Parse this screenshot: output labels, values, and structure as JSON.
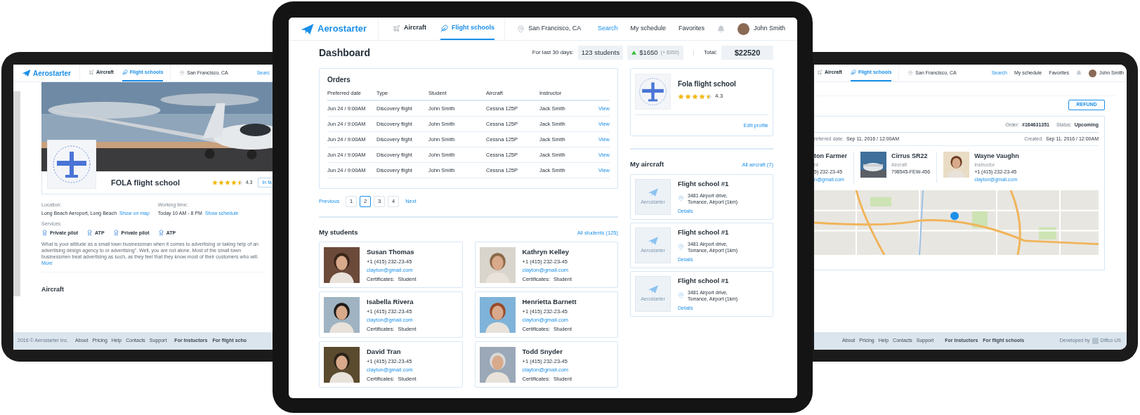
{
  "left_screen": {
    "nav": {
      "logo": "Aerostarter",
      "items": [
        {
          "label": "Aircraft",
          "selected": false
        },
        {
          "label": "Flight schools",
          "selected": true
        }
      ],
      "location": "San Francisco, CA",
      "links": [
        {
          "label": "Searc",
          "selected": true
        }
      ]
    },
    "profile": {
      "name": "FOLA flight school",
      "stars": 4.5,
      "rating": "4.3",
      "action": "In fa",
      "location_label": "Location:",
      "location": "Long Beach Aeroport, Long Beach",
      "map_link": "Show on map",
      "hours_label": "Working time:",
      "hours": "Today 10 AM - 8 PM",
      "schedule_link": "Show schedule",
      "services_label": "Services:",
      "services": [
        "Private pilot",
        "ATP",
        "Private pilot",
        "ATP"
      ],
      "description": "What is your attitude as a small town businessman when it comes to advertising or taking help of an advertising design agency to or advertising\". Well, you are not alone. Most of the small town businessmen treat advertising as such, as they feel that they know most of their customers who will.",
      "more": "More",
      "section": "Aircraft"
    },
    "footer": {
      "copyright": "2016 © Aerostarter Inc.",
      "links": [
        "About",
        "Pricing",
        "Help",
        "Contacts",
        "Support"
      ],
      "roles": [
        "For Instuctors",
        "For flight scho"
      ]
    }
  },
  "center_screen": {
    "nav": {
      "logo": "Aerostarter",
      "items": [
        {
          "label": "Aircraft",
          "selected": false
        },
        {
          "label": "Flight schools",
          "selected": true
        }
      ],
      "location": "San Francisco, CA",
      "links": [
        {
          "label": "Search",
          "selected": true
        },
        {
          "label": "My schedule",
          "selected": false
        },
        {
          "label": "Favorites",
          "selected": false
        }
      ],
      "user": "John Smith"
    },
    "dashboard": {
      "title": "Dashboard",
      "period_label": "For last 30 days:",
      "students": "123 students",
      "revenue": "$1650",
      "revenue_delta": "(+ $350)",
      "total_label": "Total:",
      "total": "$22520"
    },
    "orders": {
      "title": "Orders",
      "columns": [
        "Preferred date",
        "Type",
        "Student",
        "Aircraft",
        "Instructor"
      ],
      "rows": [
        {
          "cells": [
            "Jun 24 / 9:00AM",
            "Discovery flight",
            "John Smith",
            "Cessna 125P",
            "Jack Smith"
          ],
          "action": "View"
        },
        {
          "cells": [
            "Jun 24 / 9:00AM",
            "Discovery flight",
            "John Smith",
            "Cessna 125P",
            "Jack Smith"
          ],
          "action": "View"
        },
        {
          "cells": [
            "Jun 24 / 9:00AM",
            "Discovery flight",
            "John Smith",
            "Cessna 125P",
            "Jack Smith"
          ],
          "action": "View"
        },
        {
          "cells": [
            "Jun 24 / 9:00AM",
            "Discovery flight",
            "John Smith",
            "Cessna 125P",
            "Jack Smith"
          ],
          "action": "View"
        },
        {
          "cells": [
            "Jun 24 / 9:00AM",
            "Discovery flight",
            "John Smith",
            "Cessna 125P",
            "Jack Smith"
          ],
          "action": "View"
        }
      ]
    },
    "pagination": {
      "previous": "Previous",
      "pages": [
        {
          "label": "1",
          "selected": false
        },
        {
          "label": "2",
          "selected": true
        },
        {
          "label": "3",
          "selected": false
        },
        {
          "label": "4",
          "selected": false
        }
      ],
      "next": "Next"
    },
    "students": {
      "title": "My students",
      "link": "All students (125)",
      "items": [
        {
          "name": "Susan Thomas",
          "phone": "+1 (415) 232-23-45",
          "email": "clayton@gmail.com",
          "cert_label": "Certificates:",
          "cert": "Student"
        },
        {
          "name": "Kathryn Kelley",
          "phone": "+1 (415) 232-23-45",
          "email": "clayton@gmail.com",
          "cert_label": "Certificates:",
          "cert": "Student"
        },
        {
          "name": "Isabella Rivera",
          "phone": "+1 (415) 232-23-45",
          "email": "clayton@gmail.com",
          "cert_label": "Certificates:",
          "cert": "Student"
        },
        {
          "name": "Henrietta Barnett",
          "phone": "+1 (415) 232-23-45",
          "email": "clayton@gmail.com",
          "cert_label": "Certificates:",
          "cert": "Student"
        },
        {
          "name": "David Tran",
          "phone": "+1 (415) 232-23-45",
          "email": "clayton@gmail.com",
          "cert_label": "Certificates:",
          "cert": "Student"
        },
        {
          "name": "Todd Snyder",
          "phone": "+1 (415) 232-23-45",
          "email": "clayton@gmail.com",
          "cert_label": "Certificates:",
          "cert": "Student"
        }
      ]
    },
    "school": {
      "name": "Fola flight school",
      "stars": 4.5,
      "rating": "4.3",
      "edit": "Edit profile"
    },
    "aircraft": {
      "title": "My aircraft",
      "link": "All aircraft (7)",
      "items": [
        {
          "name": "Flight school #1",
          "address_lines": [
            "3481 Airport drive,",
            "Torrance, Airport (1km)"
          ],
          "details": "Details",
          "placeholder_label": "Aerostarter"
        },
        {
          "name": "Flight school #1",
          "address_lines": [
            "3481 Airport drive,",
            "Torrance, Airport (1km)"
          ],
          "details": "Details",
          "placeholder_label": "Aerostarter"
        },
        {
          "name": "Flight school #1",
          "address_lines": [
            "3481 Airport drive,",
            "Torrance, Airport (1km)"
          ],
          "details": "Details",
          "placeholder_label": "Aerostarter"
        }
      ]
    }
  },
  "right_screen": {
    "nav": {
      "items": [
        {
          "label": "Aircraft",
          "selected": false
        },
        {
          "label": "Flight schools",
          "selected": true
        }
      ],
      "location": "San Francisco, CA",
      "links": [
        {
          "label": "Search",
          "selected": true
        },
        {
          "label": "My schedule",
          "selected": false
        },
        {
          "label": "Favorites",
          "selected": false
        }
      ],
      "user": "John Smith"
    },
    "refund": "REFUND",
    "order": {
      "order_label": "Order:",
      "order_number": "#164631351",
      "status_label": "Status:",
      "status": "Upcoming",
      "preferred_label": "referred date:",
      "preferred": "Sep 11, 2016 / 12:00AM",
      "created_label": "Created:",
      "created": "Sep 11, 2016 / 12:00AM",
      "people": [
        {
          "kind": "partial",
          "name": "ton Farmer",
          "role": "nt",
          "line": "5) 232-23-45",
          "email": "n@gmail.com"
        },
        {
          "kind": "aircraft",
          "name": "Cirrus SR22",
          "role": "Aircraft",
          "line": "798545-FEW-456"
        },
        {
          "kind": "person",
          "name": "Wayne Vaughn",
          "role": "Instructor",
          "line": "+1 (415) 232-23-45",
          "email": "clayton@gmail.com"
        }
      ]
    },
    "footer": {
      "links": [
        "About",
        "Pricing",
        "Help",
        "Contacts",
        "Support"
      ],
      "roles": [
        "For Instuctors",
        "For flight schools"
      ],
      "developed": "Developed by",
      "developer": "Diffco US"
    }
  }
}
